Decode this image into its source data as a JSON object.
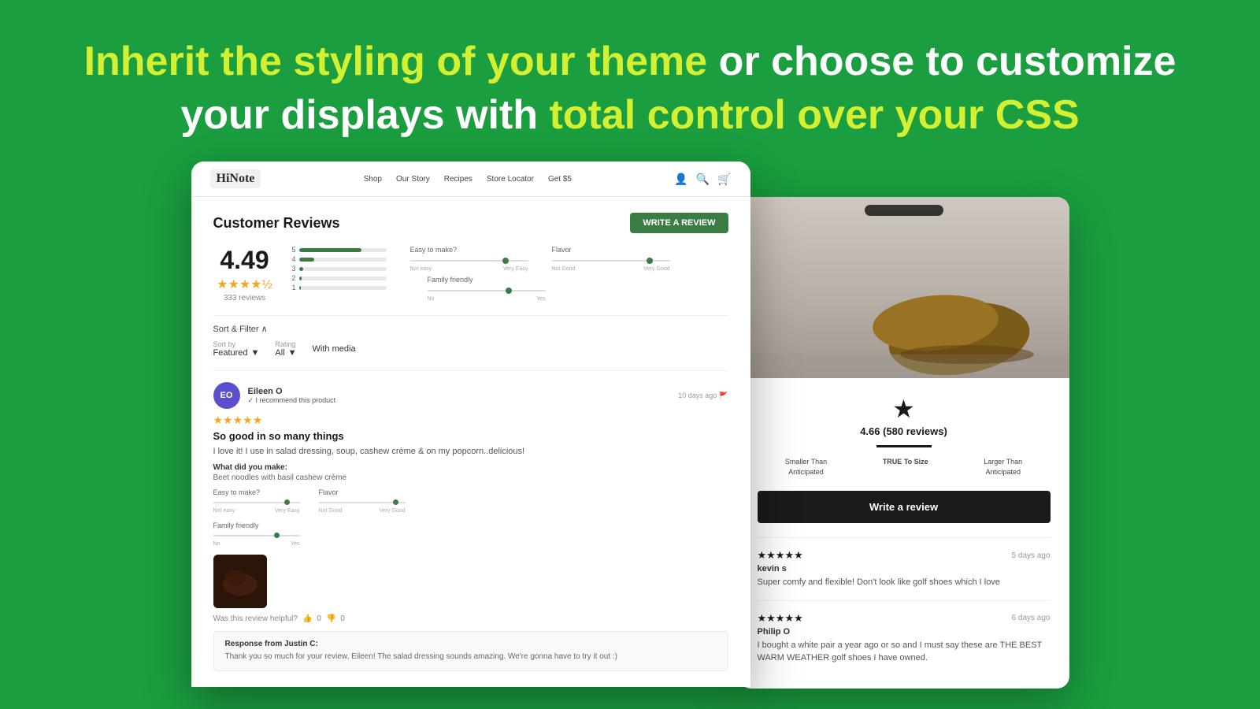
{
  "background": {
    "color": "#1a9e3f"
  },
  "hero": {
    "line1_white": "Inherit the styling of your theme",
    "line1_white_pre": "",
    "line1_connector": "or choose to customize",
    "line2_white": "your displays with",
    "line2_yellow": "total control over your CSS"
  },
  "left_screenshot": {
    "nav": {
      "logo": "HiNote",
      "links": [
        "Shop",
        "Our Story",
        "Recipes",
        "Store Locator",
        "Get $5"
      ]
    },
    "review_section": {
      "title": "Customer Reviews",
      "write_review_btn": "WRITE A REVIEW",
      "avg_rating": "4.49",
      "stars": "★★★★½",
      "reviews_count": "333 reviews",
      "bars": [
        {
          "label": "5",
          "width": "72%"
        },
        {
          "label": "4",
          "width": "18%"
        },
        {
          "label": "3",
          "width": "5%"
        },
        {
          "label": "2",
          "width": "3%"
        },
        {
          "label": "1",
          "width": "2%"
        }
      ],
      "attributes": [
        {
          "label": "Easy to make?",
          "left": "Not easy",
          "right": "Very Easy",
          "dot_pos": "78%"
        },
        {
          "label": "Flavor",
          "left": "Not Good",
          "right": "Very Good",
          "dot_pos": "82%"
        },
        {
          "label": "Family friendly",
          "left": "No",
          "right": "Yes",
          "dot_pos": "68%"
        }
      ],
      "sort_filter": "Sort & Filter ∧",
      "sort_by_label": "Sort by",
      "sort_by_value": "Featured",
      "rating_label": "Rating",
      "rating_value": "All",
      "with_media": "With media",
      "review": {
        "initials": "EO",
        "name": "Eileen O",
        "recommend": "✓ I recommend this product",
        "date": "10 days ago",
        "stars": "★★★★★",
        "headline": "So good in so many things",
        "body": "I love it! I use in salad dressing, soup, cashew crème & on my popcorn..delicious!",
        "made_label": "What did you make:",
        "made_value": "Beet noodles with basil cashew crème",
        "attr1_label": "Easy to make?",
        "attr1_left": "Not easy",
        "attr1_right": "Very Easy",
        "attr1_dot": "82%",
        "attr2_label": "Flavor",
        "attr2_left": "Not Good",
        "attr2_right": "Very Good",
        "attr2_dot": "88%",
        "attr3_label": "Family friendly",
        "attr3_left": "No",
        "attr3_right": "Yes",
        "attr3_dot": "72%",
        "helpful_text": "Was this review helpful?",
        "helpful_yes": "0",
        "helpful_no": "0",
        "response_label": "Response from Justin C:",
        "response_text": "Thank you so much for your review, Eileen! The salad dressing sounds amazing. We're gonna have to try it out :)"
      }
    }
  },
  "right_screenshot": {
    "rating_display": "★",
    "rating_text": "4.66 (580 reviews)",
    "size_fit": [
      {
        "label": "Smaller Than\nAnticipated"
      },
      {
        "label": "TRUE To Size"
      },
      {
        "label": "Larger Than\nAnticipated"
      }
    ],
    "write_review_btn": "Write a review",
    "reviews": [
      {
        "stars": "★★★★★",
        "date": "5 days ago",
        "name": "kevin s",
        "body": "Super comfy and flexible! Don't look like golf shoes which I love"
      },
      {
        "stars": "★★★★★",
        "date": "6 days ago",
        "name": "Philip O",
        "body": "I bought a white pair a year ago or so and I must say these are THE BEST WARM WEATHER golf shoes I have owned."
      }
    ]
  }
}
